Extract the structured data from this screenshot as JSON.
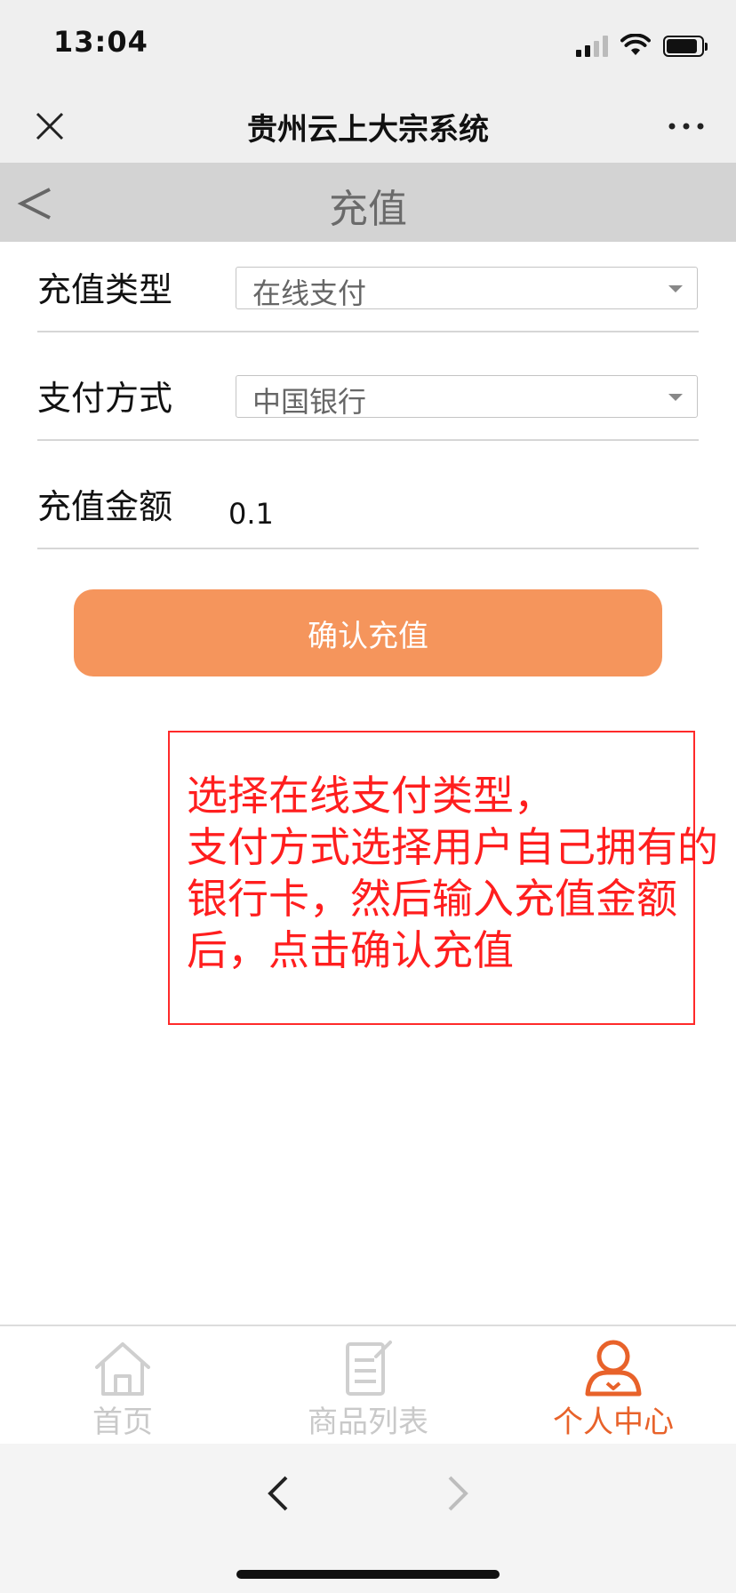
{
  "status_bar": {
    "time": "13:04",
    "battery_level": 0.9
  },
  "app_bar": {
    "title": "贵州云上大宗系统"
  },
  "page": {
    "title": "充值"
  },
  "form": {
    "recharge_type": {
      "label": "充值类型",
      "value": "在线支付"
    },
    "payment_method": {
      "label": "支付方式",
      "value": "中国银行"
    },
    "amount": {
      "label": "充值金额",
      "value": "0.1"
    },
    "submit_label": "确认充值"
  },
  "annotation": {
    "lines": [
      "选择在线支付类型，",
      "支付方式选择用户自己拥有的",
      "银行卡，然后输入充值金额",
      "后，点击确认充值"
    ]
  },
  "tab_bar": {
    "items": [
      {
        "label": "首页",
        "icon": "home-icon",
        "active": false
      },
      {
        "label": "商品列表",
        "icon": "product-list-icon",
        "active": false
      },
      {
        "label": "个人中心",
        "icon": "user-center-icon",
        "active": true
      }
    ]
  },
  "colors": {
    "accent": "#f5955c",
    "active_tab": "#e8622a",
    "annotation": "#ff1e1e"
  }
}
